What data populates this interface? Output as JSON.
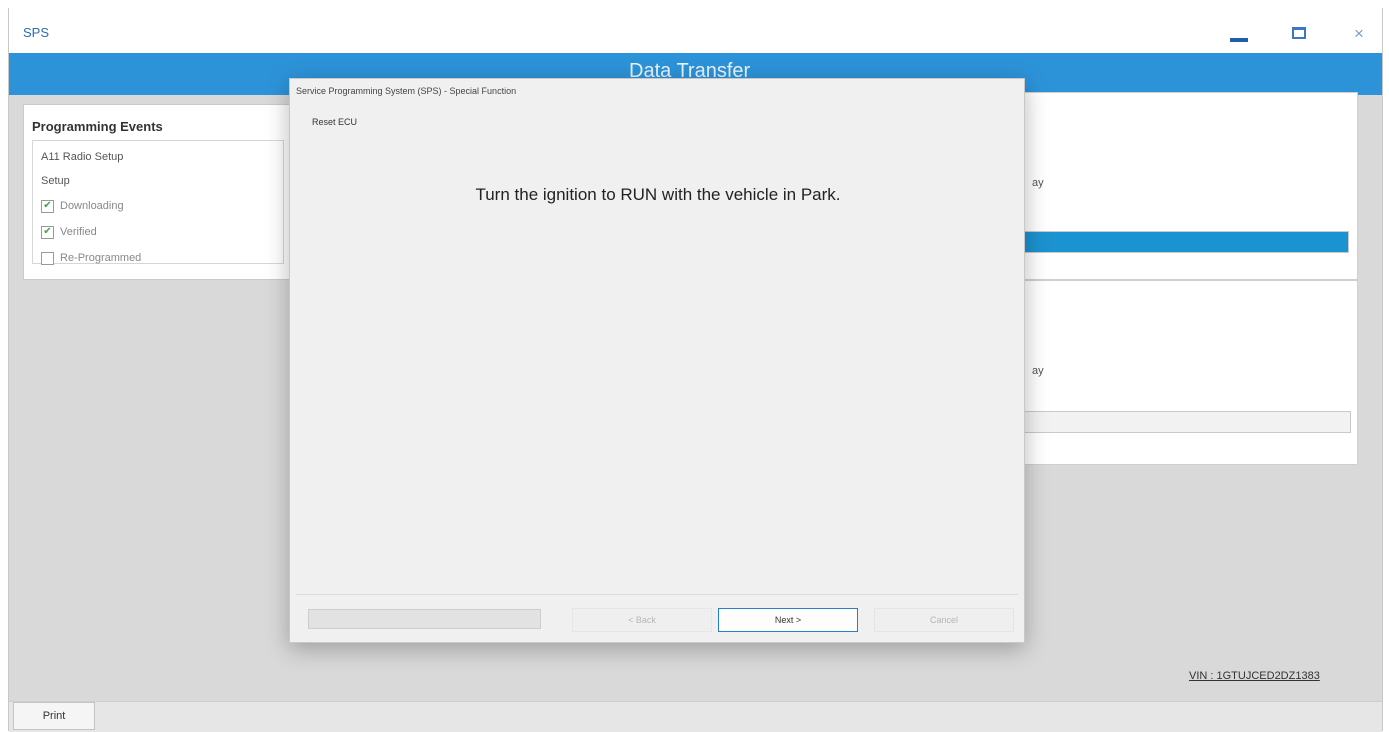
{
  "app": {
    "title": "SPS",
    "header_title": "Data Transfer"
  },
  "window_controls": {
    "minimize_icon": "minimize-icon",
    "maximize_icon": "maximize-icon",
    "close_icon": "close-icon",
    "close_glyph": "×"
  },
  "events": {
    "title": "Programming Events",
    "items": [
      {
        "label": "A11 Radio Setup"
      },
      {
        "label": "Setup"
      }
    ],
    "status": [
      {
        "label": "Downloading",
        "checked": true,
        "check_glyph": "✔"
      },
      {
        "label": "Verified",
        "checked": true,
        "check_glyph": "✔"
      },
      {
        "label": "Re-Programmed",
        "checked": false,
        "check_glyph": ""
      }
    ]
  },
  "cards": [
    {
      "text": "ay",
      "progress_percent": 100
    },
    {
      "text": "ay",
      "progress_percent": 0
    }
  ],
  "vin": "VIN : 1GTUJCED2DZ1383",
  "print_label": "Print",
  "modal": {
    "title": "Service Programming System (SPS) - Special Function",
    "subtitle": "Reset ECU",
    "message": "Turn the ignition to RUN with the vehicle in Park.",
    "back_label": "< Back",
    "next_label": "Next >",
    "cancel_label": "Cancel"
  },
  "colors": {
    "accent": "#2d93d9",
    "progress": "#1b93d1",
    "check": "#3aa64a"
  }
}
